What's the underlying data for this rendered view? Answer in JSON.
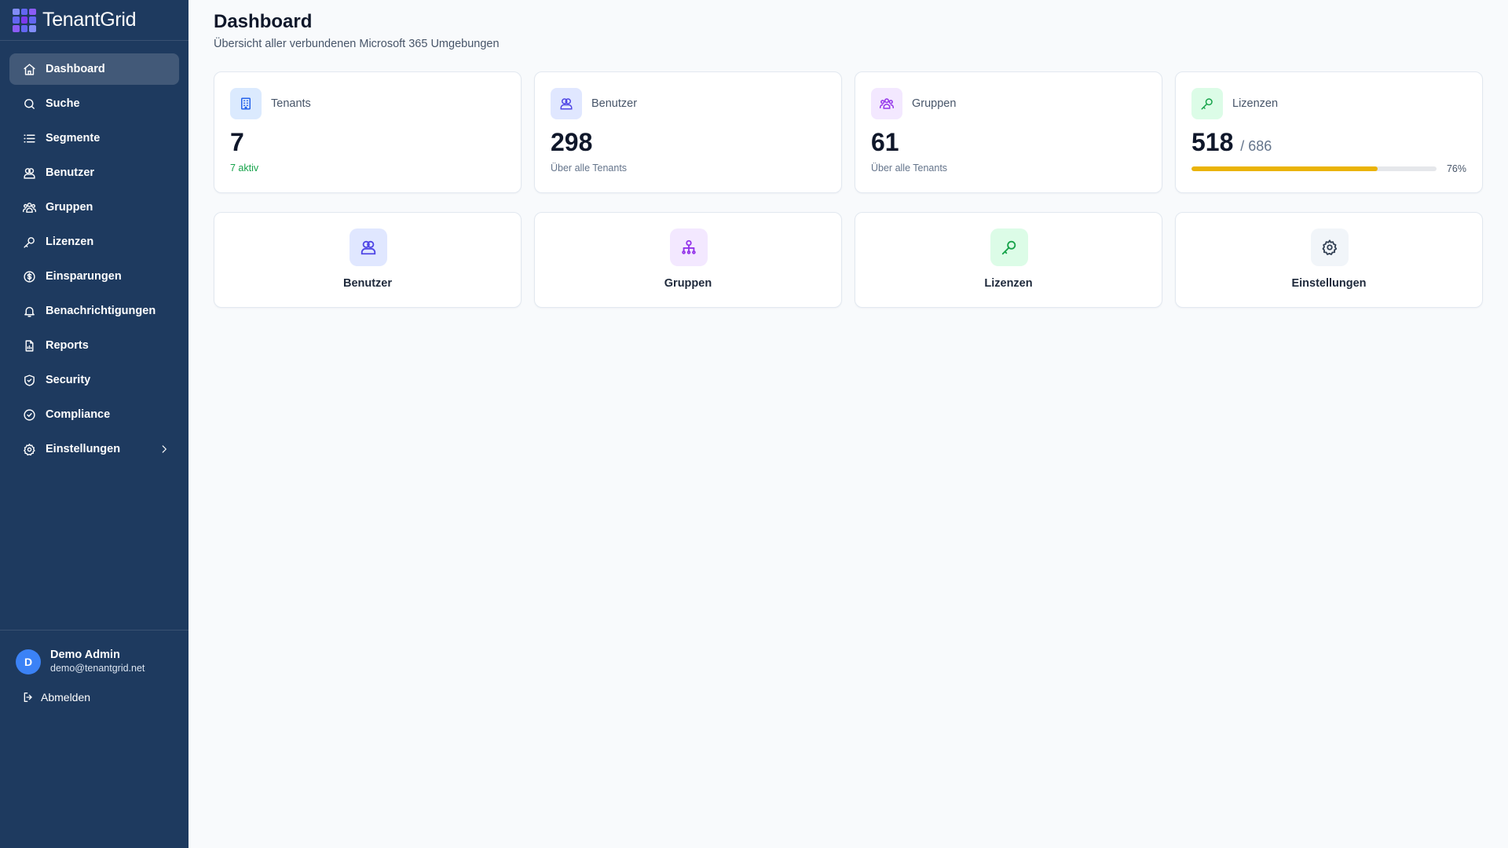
{
  "app": {
    "name": "TenantGrid"
  },
  "sidebar": {
    "items": [
      {
        "label": "Dashboard",
        "icon": "home-icon",
        "active": true
      },
      {
        "label": "Suche",
        "icon": "search-icon"
      },
      {
        "label": "Segmente",
        "icon": "list-icon"
      },
      {
        "label": "Benutzer",
        "icon": "users-icon"
      },
      {
        "label": "Gruppen",
        "icon": "groups-icon"
      },
      {
        "label": "Lizenzen",
        "icon": "key-icon"
      },
      {
        "label": "Einsparungen",
        "icon": "dollar-circle-icon"
      },
      {
        "label": "Benachrichtigungen",
        "icon": "bell-icon"
      },
      {
        "label": "Reports",
        "icon": "report-file-icon"
      },
      {
        "label": "Security",
        "icon": "shield-icon"
      },
      {
        "label": "Compliance",
        "icon": "check-circle-icon"
      },
      {
        "label": "Einstellungen",
        "icon": "gear-icon",
        "expandable": true
      }
    ],
    "user": {
      "initial": "D",
      "name": "Demo Admin",
      "email": "demo@tenantgrid.net"
    },
    "logout_label": "Abmelden"
  },
  "header": {
    "title": "Dashboard",
    "subtitle": "Übersicht aller verbundenen Microsoft 365 Umgebungen"
  },
  "stats": {
    "tenants": {
      "label": "Tenants",
      "value": "7",
      "note": "7 aktiv"
    },
    "users": {
      "label": "Benutzer",
      "value": "298",
      "note": "Über alle Tenants"
    },
    "groups": {
      "label": "Gruppen",
      "value": "61",
      "note": "Über alle Tenants"
    },
    "licenses": {
      "label": "Lizenzen",
      "value": "518",
      "total": "/ 686",
      "percent_label": "76%",
      "fill_fraction": 0.76
    }
  },
  "quick_links": {
    "users": "Benutzer",
    "groups": "Gruppen",
    "licenses": "Lizenzen",
    "settings": "Einstellungen"
  },
  "colors": {
    "sidebar_bg": "#1e3a5f",
    "accent_blue": "#3b82f6",
    "tenants_icon_bg": "#dbeafe",
    "users_icon_bg": "#e0e7ff",
    "groups_icon_bg": "#f3e8ff",
    "licenses_icon_bg": "#dcfce7",
    "settings_icon_bg": "#f1f5f9",
    "progress_fill": "#eab308",
    "active_note": "#16a34a"
  }
}
